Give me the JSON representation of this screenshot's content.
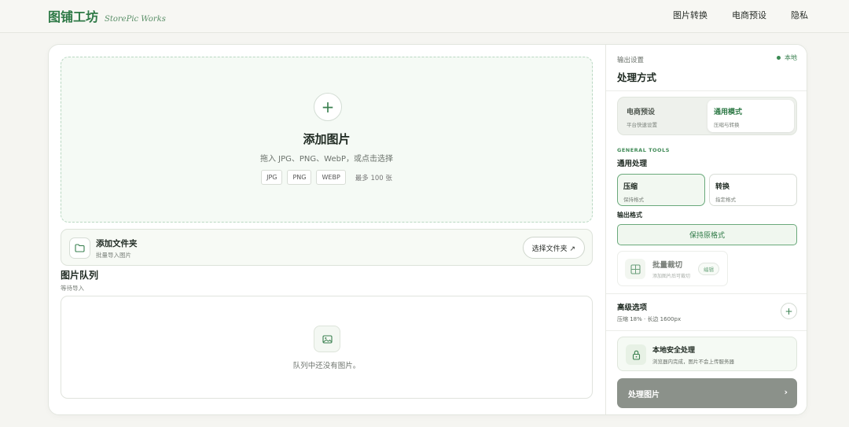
{
  "header": {
    "brand_cn": "图铺工坊",
    "brand_en": "StorePic Works",
    "nav": [
      "图片转换",
      "电商预设",
      "隐私"
    ]
  },
  "upload": {
    "plus_icon": "plus-icon",
    "title": "添加图片",
    "subtitle": "拖入 JPG、PNG、WebP，或点击选择",
    "formats": [
      "JPG",
      "PNG",
      "WEBP"
    ],
    "limit": "最多 100 张"
  },
  "folder": {
    "title": "添加文件夹",
    "subtitle": "批量导入图片",
    "button": "选择文件夹 ↗"
  },
  "queue": {
    "title": "图片队列",
    "subtitle": "等待导入",
    "empty": "队列中还没有图片。"
  },
  "panel": {
    "label": "输出设置",
    "local": "本地",
    "title": "处理方式",
    "modes": [
      {
        "title": "电商预设",
        "sub": "平台快速设置"
      },
      {
        "title": "通用模式",
        "sub": "压缩与转换"
      }
    ],
    "general_caption": "GENERAL TOOLS",
    "general_title": "通用处理",
    "tools": [
      {
        "title": "压缩",
        "sub": "保持格式"
      },
      {
        "title": "转换",
        "sub": "指定格式"
      }
    ],
    "output_format_title": "输出格式",
    "output_format_value": "保持原格式",
    "crop": {
      "title": "批量裁切",
      "sub": "添加图片后可裁切",
      "edit": "编辑"
    },
    "advanced": {
      "title": "高级选项",
      "sub": "压缩 18% · 长边 1600px"
    },
    "secure": {
      "title": "本地安全处理",
      "sub": "浏览器内完成，图片不会上传服务器"
    },
    "process_button": "处理图片",
    "process_arrow": "›"
  },
  "colors": {
    "accent": "#2f7a47",
    "accent_light": "#f0f7ef",
    "border_active": "#6aa97b"
  }
}
